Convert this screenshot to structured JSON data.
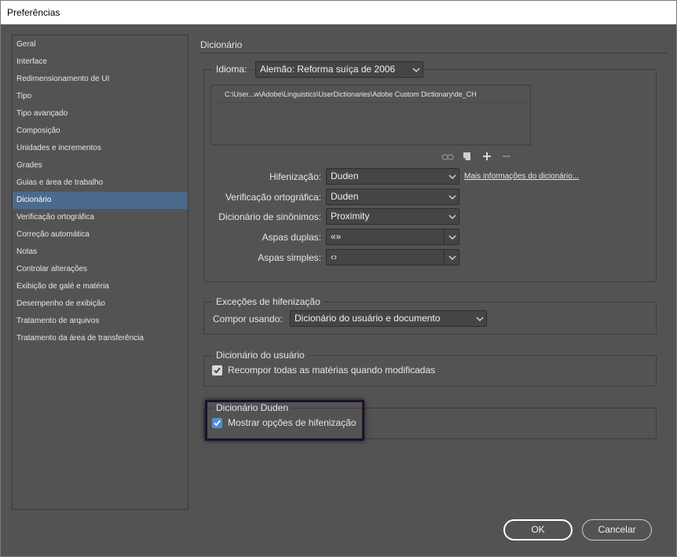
{
  "window": {
    "title": "Preferências"
  },
  "sidebar": {
    "items": [
      {
        "label": "Geral",
        "selected": false
      },
      {
        "label": "Interface",
        "selected": false
      },
      {
        "label": "Redimensionamento de UI",
        "selected": false
      },
      {
        "label": "Tipo",
        "selected": false
      },
      {
        "label": "Tipo avançado",
        "selected": false
      },
      {
        "label": "Composição",
        "selected": false
      },
      {
        "label": "Unidades e incrementos",
        "selected": false
      },
      {
        "label": "Grades",
        "selected": false
      },
      {
        "label": "Guias e área de trabalho",
        "selected": false
      },
      {
        "label": "Dicionário",
        "selected": true
      },
      {
        "label": "Verificação ortográfica",
        "selected": false
      },
      {
        "label": "Correção automática",
        "selected": false
      },
      {
        "label": "Notas",
        "selected": false
      },
      {
        "label": "Controlar alterações",
        "selected": false
      },
      {
        "label": "Exibição de galé e matéria",
        "selected": false
      },
      {
        "label": "Desempenho de exibição",
        "selected": false
      },
      {
        "label": "Tratamento de arquivos",
        "selected": false
      },
      {
        "label": "Tratamento da área de transferência",
        "selected": false
      }
    ]
  },
  "main": {
    "section_title": "Dicionário",
    "language": {
      "label": "Idioma:",
      "value": "Alemão: Reforma suíça de 2006"
    },
    "dictionary_list": {
      "rows": [
        "C:\\User...w\\Adobe\\Linguistics\\UserDictionaries\\Adobe Custom Dictionary\\de_CH"
      ]
    },
    "list_toolbar_icons": [
      "link-icon",
      "new-page-icon",
      "plus-icon",
      "minus-icon"
    ],
    "fields": {
      "hyphenation": {
        "label": "Hifenização:",
        "value": "Duden"
      },
      "spelling": {
        "label": "Verificação ortográfica:",
        "value": "Duden"
      },
      "thesaurus": {
        "label": "Dicionário de sinônimos:",
        "value": "Proximity"
      },
      "double_quotes": {
        "label": "Aspas duplas:",
        "value": "«»"
      },
      "single_quotes": {
        "label": "Aspas simples:",
        "value": "‹›"
      }
    },
    "more_info_link": "Mais informações do dicionário...",
    "hyphenation_exceptions": {
      "title": "Exceções de hifenização",
      "compose_label": "Compor usando:",
      "compose_value": "Dicionário do usuário e documento"
    },
    "user_dictionary": {
      "title": "Dicionário do usuário",
      "recompose_label": "Recompor todas as matérias quando modificadas",
      "recompose_checked": true
    },
    "duden_dictionary": {
      "title": "Dicionário Duden",
      "show_options_label": "Mostrar opções de hifenização",
      "show_options_checked": true
    }
  },
  "footer": {
    "ok_label": "OK",
    "cancel_label": "Cancelar"
  },
  "colors": {
    "background": "#535353",
    "selected_item": "#4b6a8c",
    "checkbox_accent": "#4d8fd6",
    "highlight_border": "#1e1128"
  }
}
